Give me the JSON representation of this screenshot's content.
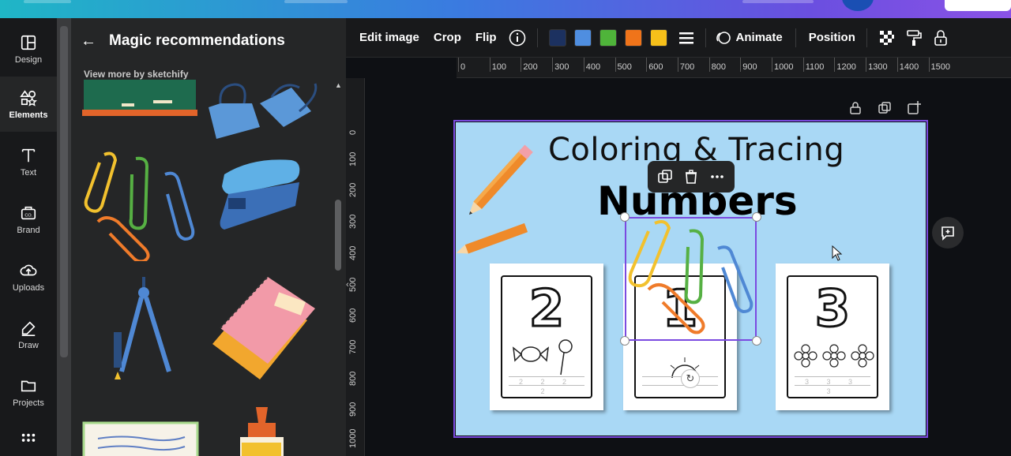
{
  "rail": {
    "items": [
      {
        "label": "Design",
        "icon": "layout-icon"
      },
      {
        "label": "Elements",
        "icon": "shapes-icon",
        "active": true
      },
      {
        "label": "Text",
        "icon": "text-icon"
      },
      {
        "label": "Brand",
        "icon": "brand-icon"
      },
      {
        "label": "Uploads",
        "icon": "cloud-upload-icon"
      },
      {
        "label": "Draw",
        "icon": "pen-icon"
      },
      {
        "label": "Projects",
        "icon": "folder-icon"
      }
    ],
    "apps_icon": "apps-grid-icon"
  },
  "panel": {
    "title": "Magic recommendations",
    "view_more": "View more by sketchify",
    "items": [
      {
        "name": "chalkboard"
      },
      {
        "name": "binder-clips"
      },
      {
        "name": "paper-clips"
      },
      {
        "name": "stapler"
      },
      {
        "name": "compass"
      },
      {
        "name": "notebooks"
      },
      {
        "name": "open-notebook"
      },
      {
        "name": "glue-bottle"
      }
    ]
  },
  "toolbar": {
    "edit_image": "Edit image",
    "crop": "Crop",
    "flip": "Flip",
    "colors": [
      "#1c3160",
      "#4f8ee0",
      "#4fb43a",
      "#f0741a",
      "#f6c01a"
    ],
    "animate": "Animate",
    "position": "Position"
  },
  "ruler": {
    "h_labels": [
      "0",
      "100",
      "200",
      "300",
      "400",
      "500",
      "600",
      "700",
      "800",
      "900",
      "1000",
      "1100",
      "1200",
      "1300",
      "1400",
      "1500"
    ],
    "v_labels": [
      "0",
      "100",
      "200",
      "300",
      "400",
      "500",
      "600",
      "700",
      "800",
      "900",
      "1000"
    ]
  },
  "design": {
    "title_line1": "Coloring & Tracing",
    "title_line2": "Numbers",
    "cards": [
      {
        "number": "2",
        "trace": "2 2 2 2"
      },
      {
        "number": "1",
        "trace": ""
      },
      {
        "number": "3",
        "trace": "3 3 3 3"
      }
    ]
  }
}
